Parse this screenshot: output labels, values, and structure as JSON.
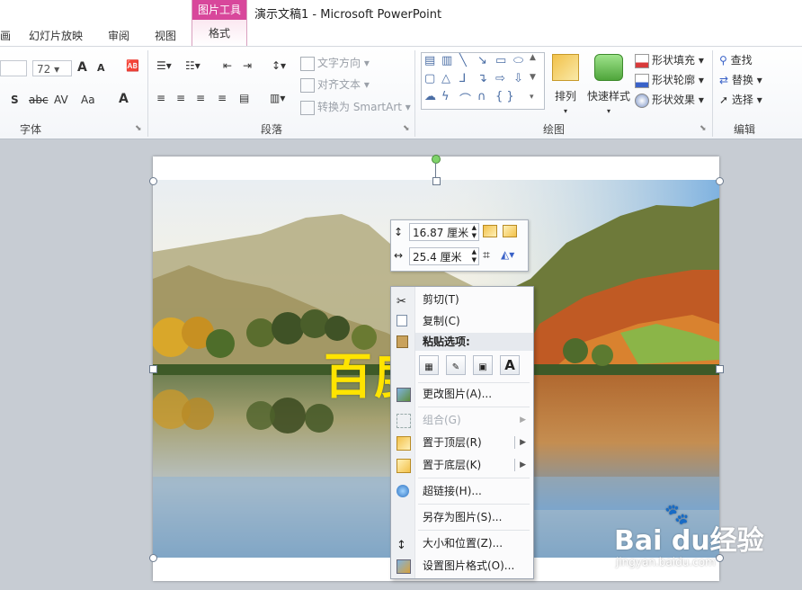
{
  "titlebar": {
    "title": "演示文稿1  -  Microsoft PowerPoint",
    "tabs": [
      "画",
      "幻灯片放映",
      "审阅",
      "视图"
    ],
    "contextual_group": "图片工具",
    "contextual_tab": "格式"
  },
  "ribbon": {
    "font_group": {
      "label": "字体",
      "size_value": "72",
      "grow_label": "A",
      "shrink_label": "A",
      "strike_label": "abc",
      "spacing_label": "AV",
      "case_label": "Aa",
      "shadow_label": "S",
      "color_label": "A"
    },
    "paragraph_group": {
      "label": "段落",
      "text_direction": "文字方向",
      "align_text": "对齐文本",
      "convert_smartart": "转换为 SmartArt"
    },
    "drawing_group": {
      "label": "绘图",
      "arrange": "排列",
      "quick_styles": "快速样式",
      "shape_fill": "形状填充",
      "shape_outline": "形状轮廓",
      "shape_effects": "形状效果"
    },
    "editing_group": {
      "label": "编辑",
      "find": "查找",
      "replace": "替换",
      "select": "选择"
    },
    "colors": {
      "accent": "#d8479b"
    }
  },
  "slide": {
    "overlay_text": "百度经验"
  },
  "mini_toolbar": {
    "height_value": "16.87 厘米",
    "width_value": "25.4 厘米"
  },
  "context_menu": {
    "items": [
      {
        "label": "剪切(T)",
        "icon": "scissors-icon"
      },
      {
        "label": "复制(C)",
        "icon": "copy-icon"
      },
      {
        "label": "粘贴选项:",
        "icon": "paste-icon"
      },
      {
        "label": "更改图片(A)...",
        "icon": "change-picture-icon"
      },
      {
        "label": "组合(G)",
        "icon": "group-icon",
        "disabled": true
      },
      {
        "label": "置于顶层(R)",
        "icon": "bring-front-icon"
      },
      {
        "label": "置于底层(K)",
        "icon": "send-back-icon"
      },
      {
        "label": "超链接(H)...",
        "icon": "hyperlink-icon"
      },
      {
        "label": "另存为图片(S)...",
        "icon": ""
      },
      {
        "label": "大小和位置(Z)...",
        "icon": "size-position-icon"
      },
      {
        "label": "设置图片格式(O)...",
        "icon": "format-picture-icon"
      }
    ],
    "paste_letter": "A"
  },
  "watermark": {
    "brand": "Bai du经验",
    "url": "jingyan.baidu.com"
  }
}
